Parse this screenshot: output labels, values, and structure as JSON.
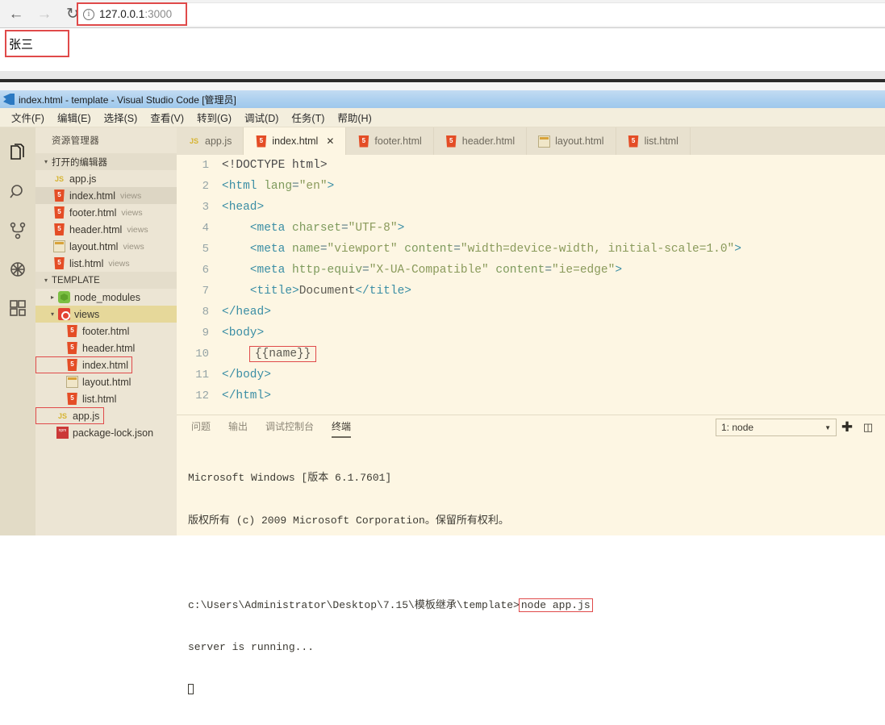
{
  "browser": {
    "back_icon": "arrow-left-icon",
    "forward_icon": "arrow-right-icon",
    "reload_icon": "reload-icon",
    "info_icon": "info-circle-icon",
    "url_host": "127.0.0.1",
    "url_port": ":3000",
    "page_content": "张三",
    "highlight_color": "#e04a4a"
  },
  "vscode": {
    "title": "index.html - template - Visual Studio Code [管理员]",
    "menu": [
      "文件(F)",
      "编辑(E)",
      "选择(S)",
      "查看(V)",
      "转到(G)",
      "调试(D)",
      "任务(T)",
      "帮助(H)"
    ],
    "activity_bar": [
      {
        "name": "explorer-icon",
        "label": "资源管理器",
        "active": true
      },
      {
        "name": "search-icon",
        "label": "搜索",
        "active": false
      },
      {
        "name": "source-control-icon",
        "label": "源代码管理",
        "active": false
      },
      {
        "name": "debug-icon",
        "label": "调试",
        "active": false
      },
      {
        "name": "extensions-icon",
        "label": "扩展",
        "active": false
      }
    ],
    "sidebar": {
      "title": "资源管理器",
      "open_editors": {
        "label": "打开的编辑器",
        "items": [
          {
            "name": "app.js",
            "suffix": "",
            "icon": "js-file-icon",
            "selected": false,
            "boxed": false
          },
          {
            "name": "index.html",
            "suffix": "views",
            "icon": "html-file-icon",
            "selected": true,
            "boxed": false
          },
          {
            "name": "footer.html",
            "suffix": "views",
            "icon": "html-file-icon",
            "selected": false,
            "boxed": false
          },
          {
            "name": "header.html",
            "suffix": "views",
            "icon": "html-file-icon",
            "selected": false,
            "boxed": false
          },
          {
            "name": "layout.html",
            "suffix": "views",
            "icon": "layout-file-icon",
            "selected": false,
            "boxed": false
          },
          {
            "name": "list.html",
            "suffix": "views",
            "icon": "html-file-icon",
            "selected": false,
            "boxed": false
          }
        ]
      },
      "workspace": {
        "label": "TEMPLATE",
        "items": [
          {
            "name": "node_modules",
            "icon": "node-folder-icon",
            "type": "folder",
            "expanded": false,
            "selected": false,
            "boxed": false
          },
          {
            "name": "views",
            "icon": "views-folder-icon",
            "type": "folder",
            "expanded": true,
            "selected": true,
            "boxed": false
          },
          {
            "name": "footer.html",
            "icon": "html-file-icon",
            "type": "file",
            "selected": false,
            "boxed": false
          },
          {
            "name": "header.html",
            "icon": "html-file-icon",
            "type": "file",
            "selected": false,
            "boxed": false
          },
          {
            "name": "index.html",
            "icon": "html-file-icon",
            "type": "file",
            "selected": false,
            "boxed": true
          },
          {
            "name": "layout.html",
            "icon": "layout-file-icon",
            "type": "file",
            "selected": false,
            "boxed": false
          },
          {
            "name": "list.html",
            "icon": "html-file-icon",
            "type": "file",
            "selected": false,
            "boxed": false
          },
          {
            "name": "app.js",
            "icon": "js-file-icon",
            "type": "file",
            "selected": false,
            "boxed": true
          },
          {
            "name": "package-lock.json",
            "icon": "npm-file-icon",
            "type": "file",
            "selected": false,
            "boxed": false
          }
        ]
      }
    },
    "tabs": [
      {
        "label": "app.js",
        "icon": "js-file-icon",
        "active": false,
        "close": ""
      },
      {
        "label": "index.html",
        "icon": "html-file-icon",
        "active": true,
        "close": "✕"
      },
      {
        "label": "footer.html",
        "icon": "html-file-icon",
        "active": false,
        "close": ""
      },
      {
        "label": "header.html",
        "icon": "html-file-icon",
        "active": false,
        "close": ""
      },
      {
        "label": "layout.html",
        "icon": "layout-file-icon",
        "active": false,
        "close": ""
      },
      {
        "label": "list.html",
        "icon": "html-file-icon",
        "active": false,
        "close": ""
      }
    ],
    "editor": {
      "lines": [
        {
          "n": "1",
          "text": "<!DOCTYPE html>"
        },
        {
          "n": "2",
          "text": "<html lang=\"en\">"
        },
        {
          "n": "3",
          "text": "<head>"
        },
        {
          "n": "4",
          "text": "    <meta charset=\"UTF-8\">"
        },
        {
          "n": "5",
          "text": "    <meta name=\"viewport\" content=\"width=device-width, initial-scale=1.0\">"
        },
        {
          "n": "6",
          "text": "    <meta http-equiv=\"X-UA-Compatible\" content=\"ie=edge\">"
        },
        {
          "n": "7",
          "text": "    <title>Document</title>"
        },
        {
          "n": "8",
          "text": "</head>"
        },
        {
          "n": "9",
          "text": "<body>"
        },
        {
          "n": "10",
          "text": "    {{name}}"
        },
        {
          "n": "11",
          "text": "</body>"
        },
        {
          "n": "12",
          "text": "</html>"
        }
      ],
      "highlighted_line": "10",
      "highlighted_text": "{{name}}"
    },
    "panel": {
      "tabs": [
        "问题",
        "输出",
        "调试控制台",
        "终端"
      ],
      "active_tab": "终端",
      "terminal_select": "1: node",
      "add_icon": "plus-icon",
      "split_icon": "split-terminal-icon",
      "terminal_lines": [
        "Microsoft Windows [版本 6.1.7601]",
        "版权所有 (c) 2009 Microsoft Corporation。保留所有权利。",
        "",
        "c:\\Users\\Administrator\\Desktop\\7.15\\模板继承\\template>",
        "server is running..."
      ],
      "terminal_prompt_path": "c:\\Users\\Administrator\\Desktop\\7.15\\模板继承\\template>",
      "terminal_command": "node app.js",
      "terminal_status": "server is running..."
    }
  }
}
